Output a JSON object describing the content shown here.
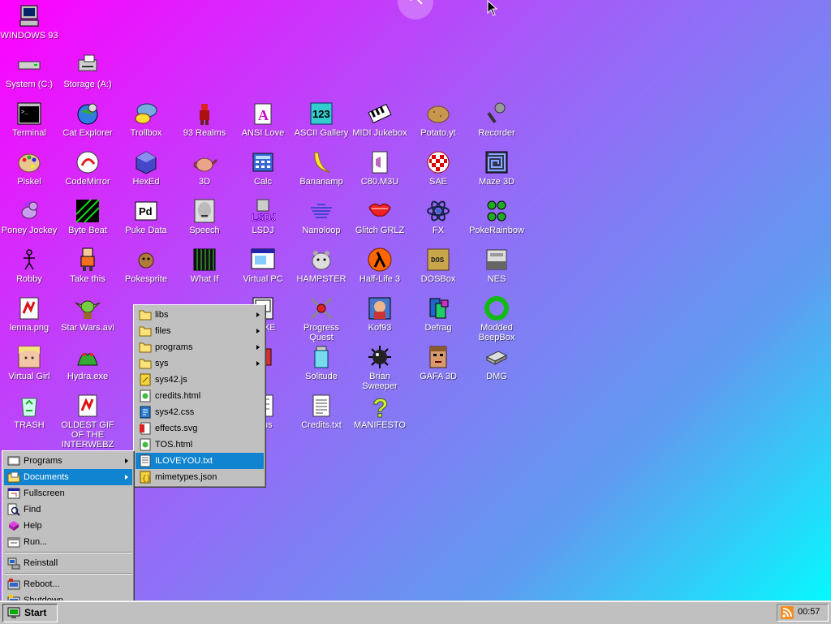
{
  "desktop": {
    "icons": [
      {
        "label": "WINDOWS 93",
        "icon": "computer-icon"
      },
      {
        "label": "System (C:)",
        "icon": "drive-icon"
      },
      {
        "label": "Storage (A:)",
        "icon": "floppy-drive-icon"
      },
      {
        "label": "Terminal",
        "icon": "terminal-icon"
      },
      {
        "label": "Cat Explorer",
        "icon": "globe-cat-icon"
      },
      {
        "label": "Trollbox",
        "icon": "chat-bubble-icon"
      },
      {
        "label": "93 Realms",
        "icon": "knight-icon"
      },
      {
        "label": "ANSI Love",
        "icon": "letter-a-icon"
      },
      {
        "label": "ASCII Gallery",
        "icon": "ascii-123-icon"
      },
      {
        "label": "MIDI Jukebox",
        "icon": "piano-icon"
      },
      {
        "label": "Potato.yt",
        "icon": "potato-icon"
      },
      {
        "label": "Recorder",
        "icon": "microphone-icon"
      },
      {
        "label": "Piskel",
        "icon": "palette-icon"
      },
      {
        "label": "CodeMirror",
        "icon": "codemirror-icon"
      },
      {
        "label": "HexEd",
        "icon": "cube-icon"
      },
      {
        "label": "3D",
        "icon": "teapot-icon"
      },
      {
        "label": "Calc",
        "icon": "calculator-icon"
      },
      {
        "label": "Bananamp",
        "icon": "banana-icon"
      },
      {
        "label": "C80.M3U",
        "icon": "playlist-icon"
      },
      {
        "label": "SAE",
        "icon": "amiga-ball-icon"
      },
      {
        "label": "Maze 3D",
        "icon": "maze-icon"
      },
      {
        "label": "Poney Jockey",
        "icon": "pony-icon"
      },
      {
        "label": "Byte Beat",
        "icon": "bytebeat-icon"
      },
      {
        "label": "Puke Data",
        "icon": "pd-icon"
      },
      {
        "label": "Speech",
        "icon": "face-icon"
      },
      {
        "label": "LSDJ",
        "icon": "gameboy-icon"
      },
      {
        "label": "Nanoloop",
        "icon": "nanoloop-icon"
      },
      {
        "label": "Glitch GRLZ",
        "icon": "lips-icon"
      },
      {
        "label": "FX",
        "icon": "atom-icon"
      },
      {
        "label": "PokeRainbow",
        "icon": "pokemon-trio-icon"
      },
      {
        "label": "Robby",
        "icon": "stick-figure-icon"
      },
      {
        "label": "Take this",
        "icon": "character-icon"
      },
      {
        "label": "Pokesprite",
        "icon": "pokemon-icon"
      },
      {
        "label": "What If",
        "icon": "whatif-icon"
      },
      {
        "label": "Virtual PC",
        "icon": "window-app-icon"
      },
      {
        "label": "HAMPSTER",
        "icon": "hamster-icon"
      },
      {
        "label": "Half-Life 3",
        "icon": "lambda-icon"
      },
      {
        "label": "DOSBox",
        "icon": "dosbox-icon"
      },
      {
        "label": "NES",
        "icon": "nes-console-icon"
      },
      {
        "label": "lenna.png",
        "icon": "image-file-icon"
      },
      {
        "label": "Star Wars.avi",
        "icon": "yoda-icon"
      },
      {
        "label": "2.EXE",
        "icon": "exe-icon"
      },
      {
        "label": "Progress Quest",
        "icon": "swords-icon"
      },
      {
        "label": "Kof93",
        "icon": "fighter-icon"
      },
      {
        "label": "Defrag",
        "icon": "defrag-icon"
      },
      {
        "label": "Modded BeepBox",
        "icon": "beepbox-icon"
      },
      {
        "label": "Virtual Girl",
        "icon": "virtual-girl-icon"
      },
      {
        "label": "Hydra.exe",
        "icon": "hydra-icon"
      },
      {
        "label": "S",
        "icon": "app-icon"
      },
      {
        "label": "Solitude",
        "icon": "solitude-icon"
      },
      {
        "label": "Brian Sweeper",
        "icon": "mine-icon"
      },
      {
        "label": "GAFA 3D",
        "icon": "doom-face-icon"
      },
      {
        "label": "DMG",
        "icon": "disk-image-icon"
      },
      {
        "label": "TRASH",
        "icon": "recycle-bin-icon"
      },
      {
        "label": "OLDEST GIF OF THE INTERWEBZ",
        "icon": "gif-file-icon"
      },
      {
        "label": "ct us",
        "icon": "contact-icon"
      },
      {
        "label": "Credits.txt",
        "icon": "text-file-icon"
      },
      {
        "label": "MANIFESTO",
        "icon": "question-mark-icon"
      }
    ]
  },
  "start_menu": {
    "items": [
      {
        "label": "Programs",
        "icon": "programs-icon",
        "submenu": true
      },
      {
        "label": "Documents",
        "icon": "documents-icon",
        "submenu": true,
        "selected": true
      },
      {
        "label": "Fullscreen",
        "icon": "fullscreen-icon"
      },
      {
        "label": "Find",
        "icon": "find-icon"
      },
      {
        "label": "Help",
        "icon": "help-icon"
      },
      {
        "label": "Run...",
        "icon": "run-icon"
      },
      {
        "label": "Reinstall",
        "icon": "reinstall-icon"
      },
      {
        "label": "Reboot...",
        "icon": "reboot-icon"
      },
      {
        "label": "Shutdown",
        "icon": "shutdown-icon"
      }
    ]
  },
  "documents_menu": {
    "items": [
      {
        "label": "libs",
        "icon": "folder-icon",
        "submenu": true
      },
      {
        "label": "files",
        "icon": "folder-icon",
        "submenu": true
      },
      {
        "label": "programs",
        "icon": "folder-icon",
        "submenu": true
      },
      {
        "label": "sys",
        "icon": "folder-icon",
        "submenu": true
      },
      {
        "label": "sys42.js",
        "icon": "js-file-icon"
      },
      {
        "label": "credits.html",
        "icon": "html-file-icon"
      },
      {
        "label": "sys42.css",
        "icon": "css-file-icon"
      },
      {
        "label": "effects.svg",
        "icon": "svg-file-icon"
      },
      {
        "label": "TOS.html",
        "icon": "html-file-icon"
      },
      {
        "label": "ILOVEYOU.txt",
        "icon": "txt-file-icon",
        "selected": true
      },
      {
        "label": "mimetypes.json",
        "icon": "json-file-icon"
      }
    ]
  },
  "taskbar": {
    "start_label": "Start",
    "clock": "00:57",
    "tray_icon": "rss-icon"
  },
  "colors": {
    "selection": "#1084d0",
    "panel": "#c0c0c0",
    "desktop_top_left": "#ff00ff",
    "desktop_bottom_right": "#00ffff"
  }
}
